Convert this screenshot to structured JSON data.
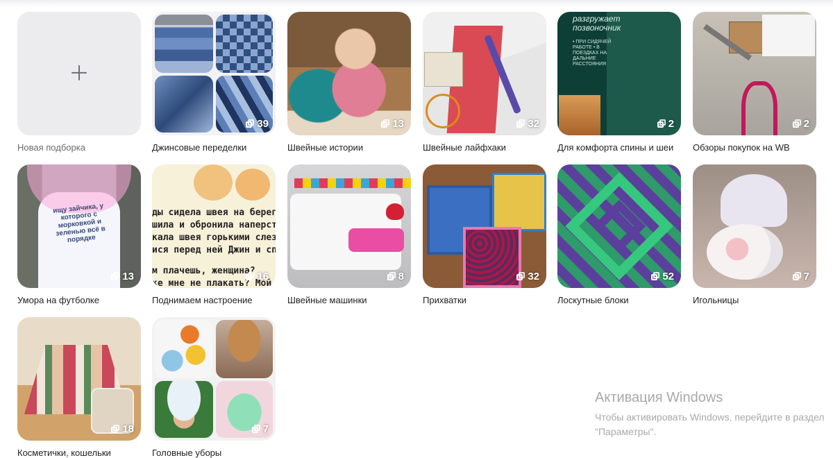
{
  "new_collection": {
    "label": "Новая подборка"
  },
  "collections": [
    {
      "title": "Джинсовые переделки",
      "count": "39"
    },
    {
      "title": "Швейные истории",
      "count": "13"
    },
    {
      "title": "Швейные лайфхаки",
      "count": "32"
    },
    {
      "title": "Для комфорта спины и шеи",
      "count": "2"
    },
    {
      "title": "Обзоры покупок на WB",
      "count": "2"
    },
    {
      "title": "Умора на футболке",
      "count": "13"
    },
    {
      "title": "Поднимаем настроение",
      "count": "16"
    },
    {
      "title": "Швейные машинки",
      "count": "8"
    },
    {
      "title": "Прихватки",
      "count": "32"
    },
    {
      "title": "Лоскутные блоки",
      "count": "52"
    },
    {
      "title": "Игольницы",
      "count": "7"
    },
    {
      "title": "Косметички, кошельки",
      "count": "18"
    },
    {
      "title": "Головные уборы",
      "count": "7"
    }
  ],
  "image_texts": {
    "book_cover": "разгружает позвоночник",
    "book_sub": "• ПРИ СИДЯЧЕЙ РАБОТЕ • В ПОЕЗДКАХ НА ДАЛЬНИЕ РАССТОЯНИЯ",
    "tshirt": "ищу зайчика, у которого с морковкой и зеленью всё в порядке",
    "meme": [
      "ды сидела швея на берегу",
      "шила и обронила наперсток в",
      "кала швея горькими слезами",
      "ися перед ней Джин и спроси",
      "м плачешь, женщина?",
      "ке мне не плакать? Мой"
    ]
  },
  "windows_activation": {
    "title": "Активация Windows",
    "line1": "Чтобы активировать Windows, перейдите в раздел",
    "line2": "\"Параметры\"."
  }
}
